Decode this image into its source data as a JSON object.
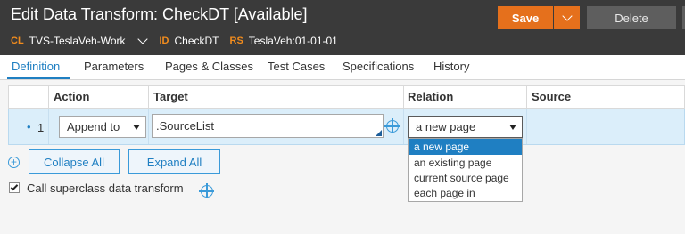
{
  "header": {
    "title": "Edit Data Transform: CheckDT [Available]",
    "meta": [
      {
        "key": "CL",
        "value": "TVS-TeslaVeh-Work"
      },
      {
        "key": "ID",
        "value": "CheckDT"
      },
      {
        "key": "RS",
        "value": "TeslaVeh:01-01-01"
      }
    ],
    "save_label": "Save",
    "delete_label": "Delete"
  },
  "tabs": [
    "Definition",
    "Parameters",
    "Pages & Classes",
    "Test Cases",
    "Specifications",
    "History"
  ],
  "active_tab": "Definition",
  "grid": {
    "columns": [
      "Action",
      "Target",
      "Relation",
      "Source"
    ],
    "row": {
      "bullet": "•",
      "number": "1",
      "action": "Append to",
      "target": ".SourceList",
      "relation": "a new page",
      "source": ""
    }
  },
  "relation_options": [
    "a new page",
    "an existing page",
    "current source page",
    "each page in"
  ],
  "selected_relation": "a new page",
  "buttons": {
    "collapse_all": "Collapse All",
    "expand_all": "Expand All"
  },
  "superclass_checkbox": {
    "label": "Call superclass data transform",
    "checked": true
  },
  "colors": {
    "header_bg": "#3a3a3a",
    "accent_orange": "#e5701c",
    "accent_blue": "#1f7fc2",
    "row_highlight": "#dbeefa"
  }
}
